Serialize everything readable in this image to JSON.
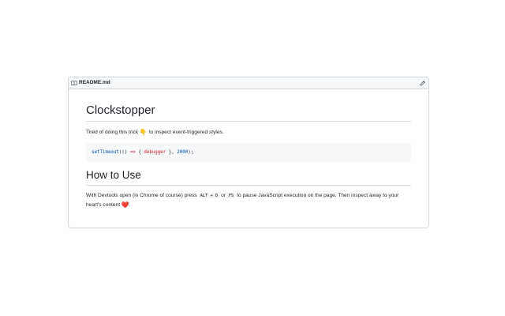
{
  "readme": {
    "file_name": "README.md",
    "icons": {
      "file": "book-icon",
      "edit": "pencil-icon"
    },
    "title": "Clockstopper",
    "intro": {
      "before": "Tired of doing this trick ",
      "emoji": "👇",
      "after": " to inspect event-triggered styles."
    },
    "code": {
      "fn": "setTimeout",
      "open": "(() ",
      "arrow": "=>",
      "brace_open": " { ",
      "keyword": "debugger",
      "brace_close": " }, ",
      "number": "2000",
      "close": ");"
    },
    "howto_heading": "How to Use",
    "howto": {
      "part1": "With Devtools open (in Chrome of course) press ",
      "key1": "ALT + D",
      "part2": " or ",
      "key2": "F5",
      "part3": " to pause JavaScript execution on the page. Then inspect away to your heart's content ",
      "emoji": "❤️",
      "part4": "."
    }
  },
  "colors": {
    "border": "#d0d7de",
    "code_bg": "#f6f8fa",
    "code_fn": "#0550ae",
    "code_keyword": "#cf222e"
  }
}
